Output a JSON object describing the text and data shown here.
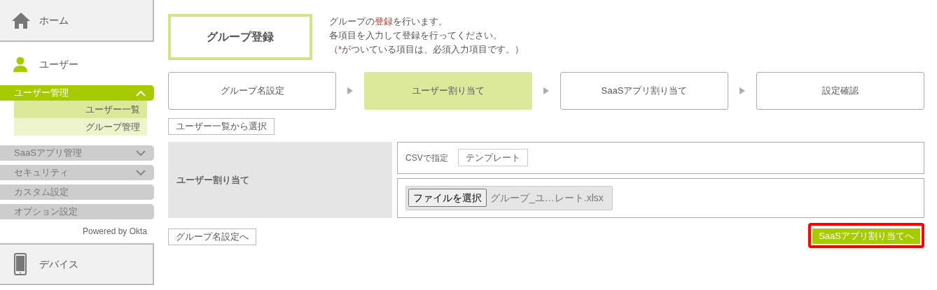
{
  "sidebar": {
    "home": {
      "label": "ホーム"
    },
    "user": {
      "label": "ユーザー"
    },
    "menus": [
      {
        "kind": "group",
        "label": "ユーザー管理",
        "expanded": true,
        "children": [
          {
            "label": "ユーザー一覧",
            "selected": true
          },
          {
            "label": "グループ管理",
            "selected": false
          }
        ]
      },
      {
        "kind": "group",
        "label": "SaaSアプリ管理",
        "expanded": false
      },
      {
        "kind": "group",
        "label": "セキュリティ",
        "expanded": false
      },
      {
        "kind": "link",
        "label": "カスタム設定"
      },
      {
        "kind": "link",
        "label": "オプション設定"
      }
    ],
    "powered_by": "Powered by Okta",
    "device": {
      "label": "デバイス"
    }
  },
  "page": {
    "title": "グループ登録",
    "description": [
      "グループの**登録**を行います。",
      "各項目を入力して登録を行ってください。"
    ],
    "required_note": {
      "prefix": "（",
      "mark": "*",
      "suffix": "がついている項目は、必須入力項目です。）"
    }
  },
  "steps": [
    {
      "label": "グループ名設定",
      "selected": false
    },
    {
      "label": "ユーザー割り当て",
      "selected": true
    },
    {
      "label": "SaaSアプリ割り当て",
      "selected": false
    },
    {
      "label": "設定確認",
      "selected": false
    }
  ],
  "select_button": "ユーザー一覧から選択",
  "form": {
    "label": "ユーザー割り当て",
    "csv_label": "CSVで指定",
    "template_button": "テンプレート",
    "file_button": "ファイルを選択",
    "file_name": "グループ_ユ…レート.xlsx"
  },
  "back_button": "グループ名設定へ",
  "next_button": {
    "label": "SaaSアプリ割り当てへ",
    "highlighted": true
  }
}
